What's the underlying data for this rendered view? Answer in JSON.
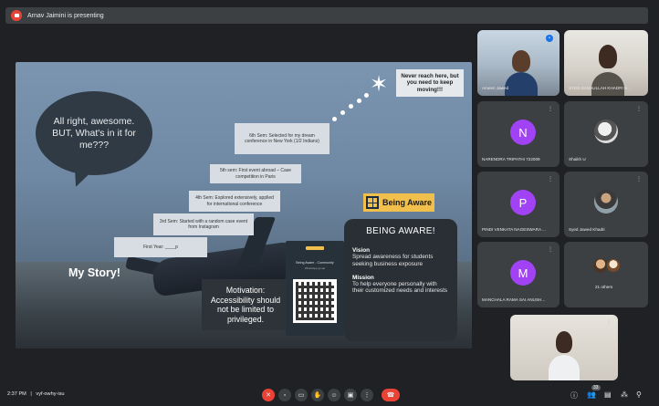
{
  "banner": {
    "text": "Arnav Jaimini is presenting"
  },
  "slide": {
    "bubble": "All right, awesome. BUT, What's in it for me???",
    "top_note": "Never reach here, but you need to keep moving!!!",
    "steps": [
      "6th Sem: Selected for my dream conference in New York (1/2 Indians)",
      "5th sem: First event abroad – Case competition in Paris",
      "4th Sem: Explored extensively, applied for international conference",
      "3rd Sem: Started with a random case event from Instagram",
      "First Year: ____p"
    ],
    "my_story": "My Story!",
    "motivation": "Motivation: Accessibility should not be limited to privileged.",
    "qr_title": "Being Aware - Community",
    "qr_sub": "WhatsApp group",
    "ba_logo": "Being Aware",
    "ba_card": {
      "heading": "BEING AWARE!",
      "vision_label": "Vision",
      "vision_text": "Spread awareness for students seeking business exposure",
      "mission_label": "Mission",
      "mission_text": "To help everyone personally with their customized needs and interests"
    }
  },
  "participants": [
    {
      "name": "Ameen Jawed",
      "type": "video"
    },
    {
      "name": "SYED SANAULLAH KHADRI S...",
      "type": "video"
    },
    {
      "name": "NARENDRA TRIPATHI 722009",
      "initial": "N",
      "color": "#a142f4"
    },
    {
      "name": "Shaikh U",
      "type": "photo"
    },
    {
      "name": "PINDI VENKATA NAGESWARA ...",
      "initial": "P",
      "color": "#a142f4"
    },
    {
      "name": "Syed Jawed Khadri",
      "type": "photo"
    },
    {
      "name": "MANCHALA RAMA SAI ANUSH...",
      "initial": "M",
      "color": "#a142f4"
    },
    {
      "name": "21 others",
      "type": "group"
    }
  ],
  "bottom": {
    "time": "2:37 PM",
    "separator": "|",
    "code": "vyf-owhy-isu",
    "badge": "33"
  },
  "colors": {
    "accent_red": "#ea4335",
    "avatar_purple": "#a142f4",
    "tile_bg": "#3c4043"
  }
}
